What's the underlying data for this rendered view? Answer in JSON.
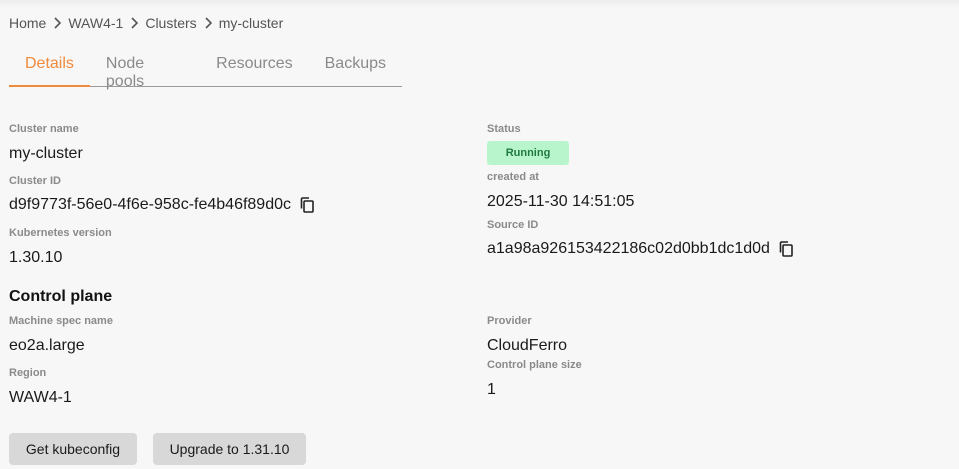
{
  "breadcrumb": [
    "Home",
    "WAW4-1",
    "Clusters",
    "my-cluster"
  ],
  "tabs": [
    "Details",
    "Node pools",
    "Resources",
    "Backups"
  ],
  "active_tab": "Details",
  "details": {
    "cluster_name_label": "Cluster name",
    "cluster_name": "my-cluster",
    "cluster_id_label": "Cluster ID",
    "cluster_id": "d9f9773f-56e0-4f6e-958c-fe4b46f89d0c",
    "k8s_version_label": "Kubernetes version",
    "k8s_version": "1.30.10",
    "status_label": "Status",
    "status": "Running",
    "created_at_label": "created at",
    "created_at": "2025-11-30 14:51:05",
    "source_id_label": "Source ID",
    "source_id": "a1a98a926153422186c02d0bb1dc1d0d"
  },
  "control_plane": {
    "title": "Control plane",
    "machine_spec_label": "Machine spec name",
    "machine_spec": "eo2a.large",
    "region_label": "Region",
    "region": "WAW4-1",
    "provider_label": "Provider",
    "provider": "CloudFerro",
    "size_label": "Control plane size",
    "size": "1"
  },
  "actions": {
    "get_kubeconfig": "Get kubeconfig",
    "upgrade": "Upgrade to 1.31.10"
  },
  "colors": {
    "accent": "#f08a3c",
    "status_bg": "#b9f5cc",
    "status_text": "#1f7a3f",
    "button_bg": "#d8d8d8"
  },
  "icons": {
    "breadcrumb_separator": "chevron-right-icon",
    "copy": "copy-icon"
  }
}
